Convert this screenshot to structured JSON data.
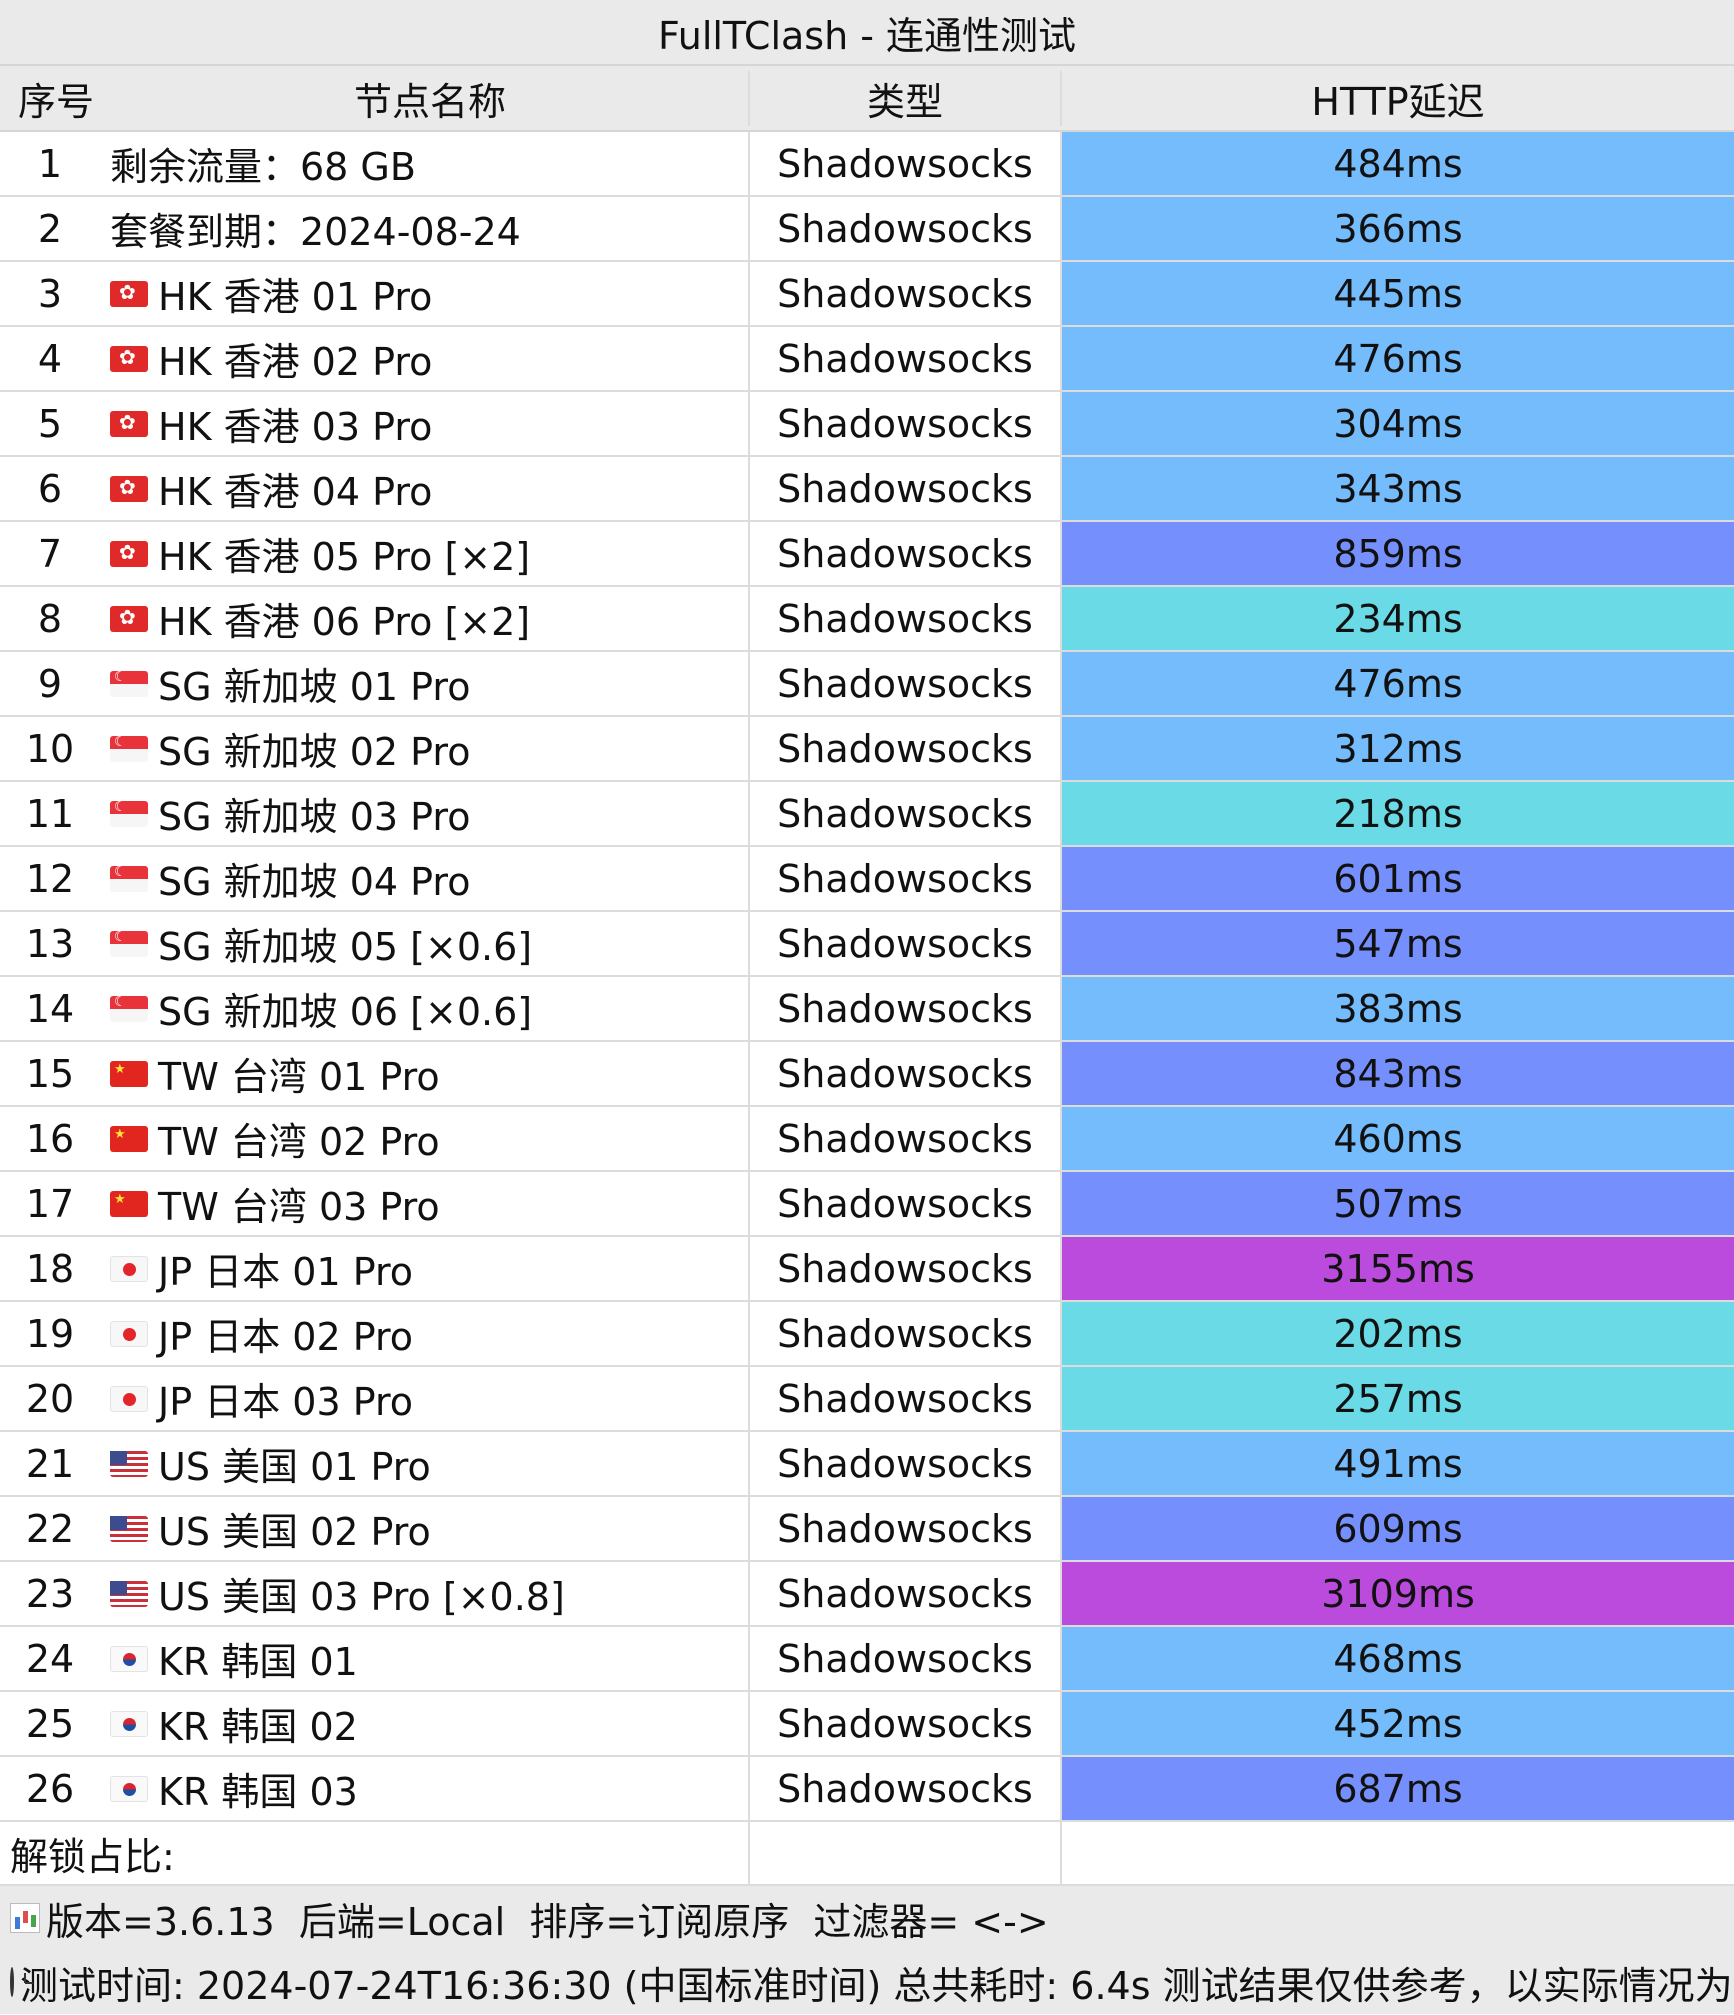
{
  "window": {
    "title": "FullTClash - 连通性测试"
  },
  "table": {
    "headers": {
      "num": "序号",
      "name": "节点名称",
      "type": "类型",
      "delay": "HTTP延迟"
    },
    "rows": [
      {
        "num": "1",
        "flag": "",
        "name": "剩余流量：68 GB",
        "type": "Shadowsocks",
        "delay": "484ms",
        "color": "#74bcfb"
      },
      {
        "num": "2",
        "flag": "",
        "name": "套餐到期：2024-08-24",
        "type": "Shadowsocks",
        "delay": "366ms",
        "color": "#74bcfb"
      },
      {
        "num": "3",
        "flag": "hk-flag-icon",
        "name": "HK 香港 01 Pro",
        "type": "Shadowsocks",
        "delay": "445ms",
        "color": "#74bcfb"
      },
      {
        "num": "4",
        "flag": "hk-flag-icon",
        "name": "HK 香港 02 Pro",
        "type": "Shadowsocks",
        "delay": "476ms",
        "color": "#74bcfb"
      },
      {
        "num": "5",
        "flag": "hk-flag-icon",
        "name": "HK 香港 03 Pro",
        "type": "Shadowsocks",
        "delay": "304ms",
        "color": "#74bcfb"
      },
      {
        "num": "6",
        "flag": "hk-flag-icon",
        "name": "HK 香港 04 Pro",
        "type": "Shadowsocks",
        "delay": "343ms",
        "color": "#74bcfb"
      },
      {
        "num": "7",
        "flag": "hk-flag-icon",
        "name": "HK 香港 05 Pro [×2]",
        "type": "Shadowsocks",
        "delay": "859ms",
        "color": "#7590fc"
      },
      {
        "num": "8",
        "flag": "hk-flag-icon",
        "name": "HK 香港 06 Pro [×2]",
        "type": "Shadowsocks",
        "delay": "234ms",
        "color": "#6adae6"
      },
      {
        "num": "9",
        "flag": "sg-flag-icon",
        "name": "SG 新加坡 01 Pro",
        "type": "Shadowsocks",
        "delay": "476ms",
        "color": "#74bcfb"
      },
      {
        "num": "10",
        "flag": "sg-flag-icon",
        "name": "SG 新加坡 02 Pro",
        "type": "Shadowsocks",
        "delay": "312ms",
        "color": "#74bcfb"
      },
      {
        "num": "11",
        "flag": "sg-flag-icon",
        "name": "SG 新加坡 03 Pro",
        "type": "Shadowsocks",
        "delay": "218ms",
        "color": "#6adae6"
      },
      {
        "num": "12",
        "flag": "sg-flag-icon",
        "name": "SG 新加坡 04 Pro",
        "type": "Shadowsocks",
        "delay": "601ms",
        "color": "#7590fc"
      },
      {
        "num": "13",
        "flag": "sg-flag-icon",
        "name": "SG 新加坡 05 [×0.6]",
        "type": "Shadowsocks",
        "delay": "547ms",
        "color": "#7590fc"
      },
      {
        "num": "14",
        "flag": "sg-flag-icon",
        "name": "SG 新加坡 06 [×0.6]",
        "type": "Shadowsocks",
        "delay": "383ms",
        "color": "#74bcfb"
      },
      {
        "num": "15",
        "flag": "tw-flag-icon",
        "name": "TW 台湾 01 Pro",
        "type": "Shadowsocks",
        "delay": "843ms",
        "color": "#7590fc"
      },
      {
        "num": "16",
        "flag": "tw-flag-icon",
        "name": "TW 台湾 02 Pro",
        "type": "Shadowsocks",
        "delay": "460ms",
        "color": "#74bcfb"
      },
      {
        "num": "17",
        "flag": "tw-flag-icon",
        "name": "TW 台湾 03 Pro",
        "type": "Shadowsocks",
        "delay": "507ms",
        "color": "#7590fc"
      },
      {
        "num": "18",
        "flag": "jp-flag-icon",
        "name": "JP 日本 01 Pro",
        "type": "Shadowsocks",
        "delay": "3155ms",
        "color": "#bb4bdc"
      },
      {
        "num": "19",
        "flag": "jp-flag-icon",
        "name": "JP 日本 02 Pro",
        "type": "Shadowsocks",
        "delay": "202ms",
        "color": "#6adae6"
      },
      {
        "num": "20",
        "flag": "jp-flag-icon",
        "name": "JP 日本 03 Pro",
        "type": "Shadowsocks",
        "delay": "257ms",
        "color": "#6adae6"
      },
      {
        "num": "21",
        "flag": "us-flag-icon",
        "name": "US 美国 01 Pro",
        "type": "Shadowsocks",
        "delay": "491ms",
        "color": "#74bcfb"
      },
      {
        "num": "22",
        "flag": "us-flag-icon",
        "name": "US 美国 02 Pro",
        "type": "Shadowsocks",
        "delay": "609ms",
        "color": "#7590fc"
      },
      {
        "num": "23",
        "flag": "us-flag-icon",
        "name": "US 美国 03 Pro [×0.8]",
        "type": "Shadowsocks",
        "delay": "3109ms",
        "color": "#bb4bdc"
      },
      {
        "num": "24",
        "flag": "kr-flag-icon",
        "name": "KR 韩国 01",
        "type": "Shadowsocks",
        "delay": "468ms",
        "color": "#74bcfb"
      },
      {
        "num": "25",
        "flag": "kr-flag-icon",
        "name": "KR 韩国 02",
        "type": "Shadowsocks",
        "delay": "452ms",
        "color": "#74bcfb"
      },
      {
        "num": "26",
        "flag": "kr-flag-icon",
        "name": "KR 韩国 03",
        "type": "Shadowsocks",
        "delay": "687ms",
        "color": "#7590fc"
      }
    ],
    "unlock_label": "解锁占比:"
  },
  "footer": {
    "line1_icon": "bar-chart-icon",
    "line1": "版本=3.6.13  后端=Local  排序=订阅原序  过滤器= <->",
    "line2_icon": "clock-icon",
    "line2": "测试时间: 2024-07-24T16:36:30 (中国标准时间) 总共耗时: 6.4s 测试结果仅供参考，以实际情况为准"
  }
}
